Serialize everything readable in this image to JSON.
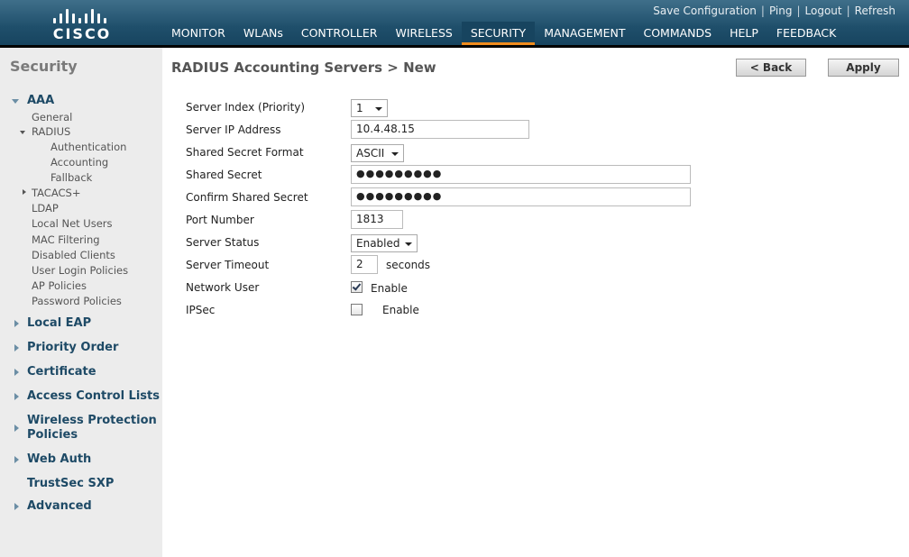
{
  "brand": {
    "logo_text": "CISCO"
  },
  "top_links": {
    "save_config": "Save Configuration",
    "ping": "Ping",
    "logout": "Logout",
    "refresh": "Refresh"
  },
  "main_nav": [
    {
      "label": "MONITOR"
    },
    {
      "label": "WLANs"
    },
    {
      "label": "CONTROLLER"
    },
    {
      "label": "WIRELESS"
    },
    {
      "label": "SECURITY",
      "active": true
    },
    {
      "label": "MANAGEMENT"
    },
    {
      "label": "COMMANDS"
    },
    {
      "label": "HELP"
    },
    {
      "label": "FEEDBACK"
    }
  ],
  "sidebar": {
    "title": "Security",
    "aaa": {
      "label": "AAA",
      "general": "General",
      "radius": "RADIUS",
      "authentication": "Authentication",
      "accounting": "Accounting",
      "fallback": "Fallback",
      "tacacs": "TACACS+",
      "ldap": "LDAP",
      "local_net_users": "Local Net Users",
      "mac_filtering": "MAC Filtering",
      "disabled_clients": "Disabled Clients",
      "user_login_policies": "User Login Policies",
      "ap_policies": "AP Policies",
      "password_policies": "Password Policies"
    },
    "local_eap": "Local EAP",
    "priority_order": "Priority Order",
    "certificate": "Certificate",
    "acl": "Access Control Lists",
    "wpp_line1": "Wireless Protection",
    "wpp_line2": "Policies",
    "web_auth": "Web Auth",
    "trustsec": "TrustSec SXP",
    "advanced": "Advanced"
  },
  "page": {
    "title": "RADIUS Accounting Servers > New",
    "back_label": "< Back",
    "apply_label": "Apply"
  },
  "form": {
    "server_index_label": "Server Index (Priority)",
    "server_index_value": "1",
    "server_ip_label": "Server IP Address",
    "server_ip_value": "10.4.48.15",
    "secret_format_label": "Shared Secret Format",
    "secret_format_value": "ASCII",
    "shared_secret_label": "Shared Secret",
    "shared_secret_value": "●●●●●●●●●",
    "confirm_secret_label": "Confirm Shared Secret",
    "confirm_secret_value": "●●●●●●●●●",
    "port_label": "Port Number",
    "port_value": "1813",
    "status_label": "Server Status",
    "status_value": "Enabled",
    "timeout_label": "Server Timeout",
    "timeout_value": "2",
    "timeout_unit": "seconds",
    "network_user_label": "Network User",
    "network_user_checked": true,
    "network_user_enable": "Enable",
    "ipsec_label": "IPSec",
    "ipsec_checked": false,
    "ipsec_enable": "Enable"
  },
  "colors": {
    "header": "#1f4f6b",
    "active_tab_underline": "#f08c1e",
    "sidebar_bg": "#ececec",
    "sidebar_link": "#1e4a66"
  }
}
